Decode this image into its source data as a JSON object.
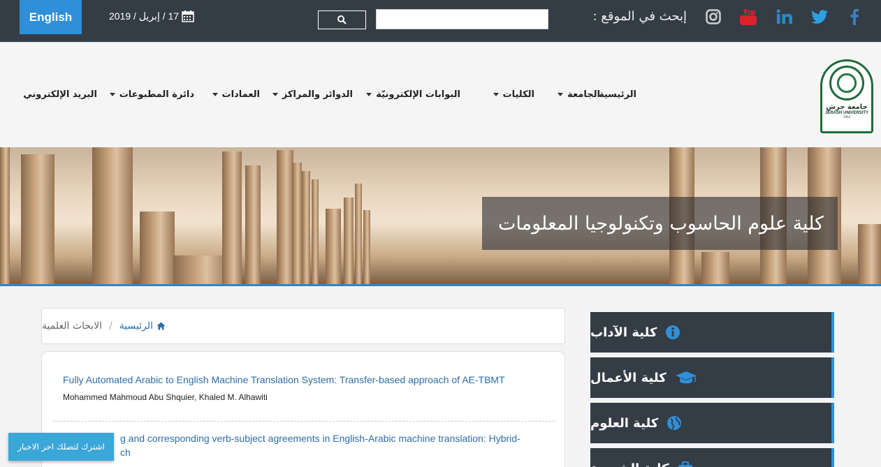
{
  "topbar": {
    "language_button": "English",
    "date": "17 / إبريل / 2019",
    "search_label": "إبحث في الموقع :",
    "search_placeholder": "",
    "social_icons": [
      "facebook-icon",
      "twitter-icon",
      "linkedin-icon",
      "youtube-icon",
      "instagram-icon"
    ]
  },
  "logo": {
    "arabic_name": "جامعة جرش",
    "english_name": "JERASH UNIVERSITY",
    "year": "1993"
  },
  "nav": {
    "items": [
      {
        "label": "الرئيسية",
        "dropdown": false
      },
      {
        "label": "الجامعة",
        "dropdown": true
      },
      {
        "label": "الكليات",
        "dropdown": true
      },
      {
        "label": "البوابات الإلكترونيّة",
        "dropdown": true
      },
      {
        "label": "الدوائر والمراكز",
        "dropdown": true
      },
      {
        "label": "العمادات",
        "dropdown": true
      },
      {
        "label": "دائرة المطبوعات",
        "dropdown": true
      },
      {
        "label": "البريد الإلكتروني",
        "dropdown": false
      }
    ]
  },
  "banner": {
    "title": "كلية علوم الحاسوب وتكنولوجيا المعلومات"
  },
  "breadcrumb": {
    "home": "الرئيسية",
    "separator": "/",
    "current": "الابحاث العلمية"
  },
  "research": {
    "items": [
      {
        "title": "Fully Automated Arabic to English Machine Translation System: Transfer-based approach of AE-TBMT",
        "authors": "Mohammed Mahmoud Abu Shquier, Khaled M. Alhawiti"
      },
      {
        "title": "g and corresponding verb-subject agreements in English-Arabic machine translation: Hybrid-",
        "title_line2": "ch",
        "authors": ""
      }
    ]
  },
  "sidebar": {
    "items": [
      {
        "label": "كلية الآداب",
        "icon": "info-icon"
      },
      {
        "label": "كلية الأعمال",
        "icon": "graduation-cap-icon"
      },
      {
        "label": "كلية العلوم",
        "icon": "globe-icon"
      },
      {
        "label": "كلية الشريعة",
        "icon": "briefcase-icon"
      }
    ]
  },
  "subscribe": {
    "label": "اشترك لتصلك اخر الاخبار"
  },
  "colors": {
    "topbar": "#343c46",
    "accent": "#2f8fd8",
    "link": "#2d6da8"
  }
}
